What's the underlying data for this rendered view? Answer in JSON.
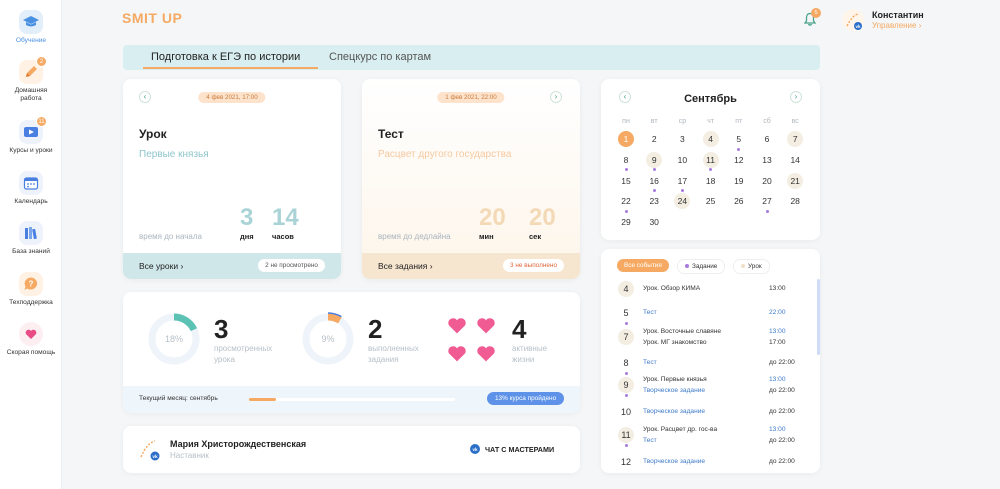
{
  "sidebar": {
    "items": [
      {
        "label": "Обучение",
        "icon": "graduation-cap-icon"
      },
      {
        "label": "Домашняя работа",
        "icon": "pencil-icon",
        "badge": "2"
      },
      {
        "label": "Курсы и уроки",
        "icon": "play-video-icon",
        "badge": "11"
      },
      {
        "label": "Календарь",
        "icon": "calendar-icon"
      },
      {
        "label": "База знаний",
        "icon": "books-icon"
      },
      {
        "label": "Техподдержка",
        "icon": "question-bubble-icon"
      },
      {
        "label": "Скорая помощь",
        "icon": "heart-icon"
      }
    ]
  },
  "header": {
    "logo": "SMIT UP",
    "notifications_count": "5",
    "user_name": "Константин",
    "user_role": "Управление",
    "user_role_chevron": "›"
  },
  "tabs": [
    {
      "label": "Подготовка к ЕГЭ по истории",
      "active": true
    },
    {
      "label": "Спецкурс по картам",
      "active": false
    }
  ],
  "lesson_card": {
    "date": "4 фев 2021, 17:00",
    "type": "Урок",
    "title": "Первые князья",
    "note": "время до начала",
    "n1": "3",
    "u1": "дня",
    "n2": "14",
    "u2": "часов",
    "footer_link": "Все уроки",
    "footer_pill": "2 не просмотрено",
    "accent": "#8ec5c9",
    "footer_bg": "#cfe7e9"
  },
  "test_card": {
    "date": "1 фев 2021, 22:00",
    "type": "Тест",
    "title": "Расцвет другого государства",
    "note": "время до дедлайна",
    "n1": "20",
    "u1": "мин",
    "n2": "20",
    "u2": "сек",
    "footer_link": "Все задания",
    "footer_pill": "3 не выполнено",
    "accent": "#f5c9a0",
    "footer_bg": "#f6e5cf"
  },
  "stats": {
    "items": [
      {
        "percent_label": "18%",
        "value": "3",
        "label_line1": "просмотренных",
        "label_line2": "урока",
        "fraction": 0.18,
        "color": "#5cc3b4"
      },
      {
        "percent_label": "9%",
        "value": "2",
        "label_line1": "выполненных",
        "label_line2": "задания",
        "fraction": 0.09,
        "color": "#f5a962"
      },
      {
        "value": "4",
        "label_line1": "активные",
        "label_line2": "жизни"
      }
    ],
    "month_label": "Текущий месяц: сентябрь",
    "course_progress_label": "13% курса пройдено",
    "course_progress": 0.13
  },
  "mentor": {
    "name": "Мария Христорождественская",
    "role": "Наставник",
    "chat_label": "ЧАТ С МАСТЕРАМИ"
  },
  "calendar": {
    "month": "Сентябрь",
    "weekdays": [
      "пн",
      "вт",
      "ср",
      "чт",
      "пт",
      "сб",
      "вс"
    ],
    "weeks": [
      [
        "1",
        "2",
        "3",
        "4",
        "5",
        "6",
        "7"
      ],
      [
        "8",
        "9",
        "10",
        "11",
        "12",
        "13",
        "14"
      ],
      [
        "15",
        "16",
        "17",
        "18",
        "19",
        "20",
        "21"
      ],
      [
        "22",
        "23",
        "24",
        "25",
        "26",
        "27",
        "28"
      ],
      [
        "29",
        "30",
        "",
        "",
        "",
        "",
        ""
      ]
    ]
  },
  "events": {
    "filters": [
      "Все события",
      "Задание",
      "Урок"
    ],
    "rows": [
      {
        "day": "4",
        "lines": [
          {
            "text": "Урок. Обзор КИМА",
            "time": "13:00",
            "kind": "lesson"
          }
        ]
      },
      {
        "day": "5",
        "lines": [
          {
            "text": "Тест",
            "time": "22:00",
            "kind": "task"
          }
        ]
      },
      {
        "day": "7",
        "lines": [
          {
            "text": "Урок. Восточные славяне",
            "time": "13:00",
            "kind": "lesson"
          },
          {
            "text": "Урок. МГ знакомство",
            "time": "17:00",
            "kind": "lesson"
          }
        ]
      },
      {
        "day": "8",
        "lines": [
          {
            "text": "Тест",
            "time": "до 22:00",
            "kind": "task"
          }
        ]
      },
      {
        "day": "9",
        "lines": [
          {
            "text": "Урок. Первые князья",
            "time": "13:00",
            "kind": "lesson"
          },
          {
            "text": "Творческое задание",
            "time": "до 22:00",
            "kind": "task"
          }
        ]
      },
      {
        "day": "10",
        "lines": [
          {
            "text": "Творческое задание",
            "time": "до 22:00",
            "kind": "task"
          }
        ]
      },
      {
        "day": "11",
        "lines": [
          {
            "text": "Урок. Расцвет др. гос-ва",
            "time": "13:00",
            "kind": "lesson"
          },
          {
            "text": "Тест",
            "time": "до 22:00",
            "kind": "task"
          }
        ]
      },
      {
        "day": "12",
        "lines": [
          {
            "text": "Творческое задание",
            "time": "до 22:00",
            "kind": "task"
          }
        ]
      }
    ]
  }
}
